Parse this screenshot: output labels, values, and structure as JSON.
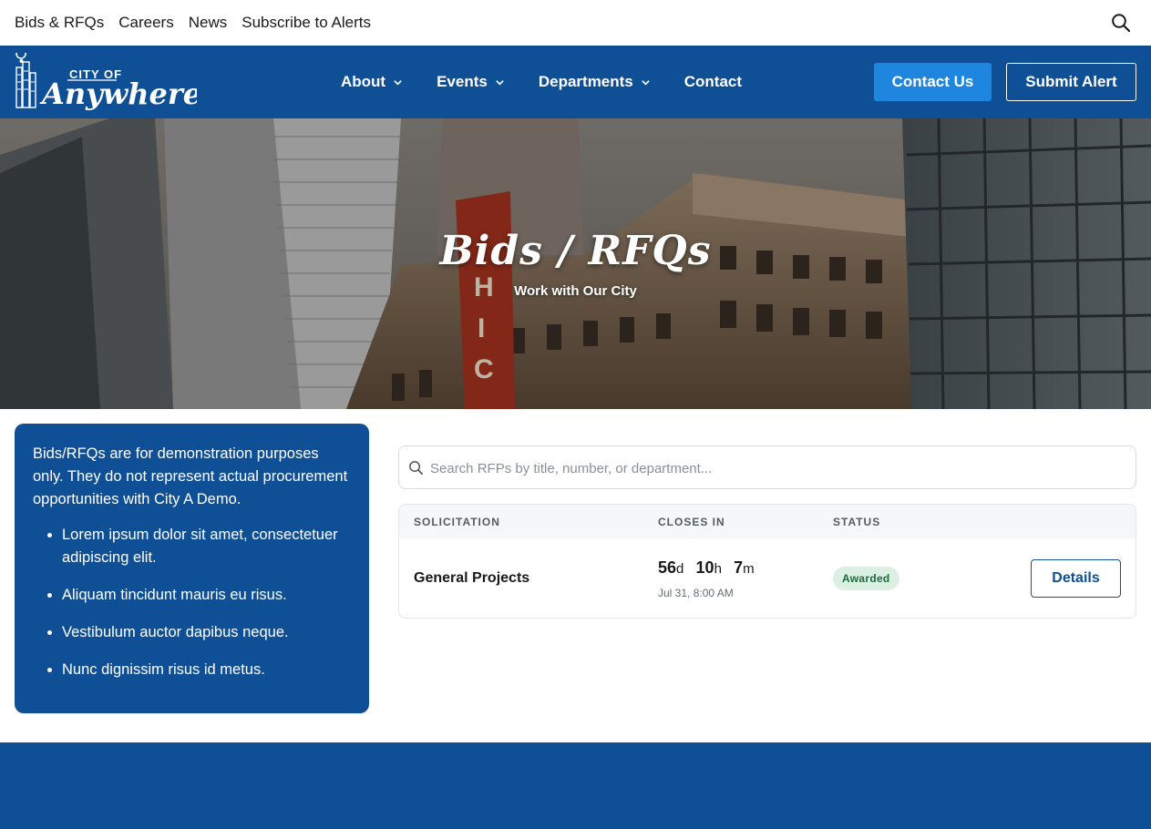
{
  "topbar": {
    "links": [
      "Bids & RFQs",
      "Careers",
      "News",
      "Subscribe to Alerts"
    ],
    "search_icon": "search-icon"
  },
  "nav": {
    "logo_top": "CITY OF",
    "logo_main": "Anywhere",
    "items": [
      {
        "label": "About",
        "has_dropdown": true
      },
      {
        "label": "Events",
        "has_dropdown": true
      },
      {
        "label": "Departments",
        "has_dropdown": true
      },
      {
        "label": "Contact",
        "has_dropdown": false
      }
    ],
    "contact_button": "Contact Us",
    "alert_button": "Submit Alert"
  },
  "hero": {
    "title": "Bids / RFQs",
    "subtitle": "Work with Our City"
  },
  "info": {
    "text": "Bids/RFQs are for demonstration purposes only. They do not represent actual procurement opportunities with City A Demo.",
    "bullets": [
      "Lorem ipsum dolor sit amet, consectetuer adipiscing elit.",
      "Aliquam tincidunt mauris eu risus.",
      "Vestibulum auctor dapibus neque.",
      "Nunc dignissim risus id metus."
    ]
  },
  "search": {
    "placeholder": "Search RFPs by title, number, or department..."
  },
  "table": {
    "headers": [
      "SOLICITATION",
      "CLOSES IN",
      "STATUS"
    ],
    "rows": [
      {
        "title": "General Projects",
        "days": "56",
        "hours": "10",
        "minutes": "7",
        "unit_d": "d",
        "unit_h": "h",
        "unit_m": "m",
        "close_date": "Jul 31, 8:00 AM",
        "status": "Awarded",
        "action": "Details"
      }
    ]
  },
  "colors": {
    "brand_blue": "#0f4f96",
    "accent_blue": "#1f86e0",
    "status_green_bg": "#dcefe3",
    "status_green_text": "#1b6b3e"
  }
}
